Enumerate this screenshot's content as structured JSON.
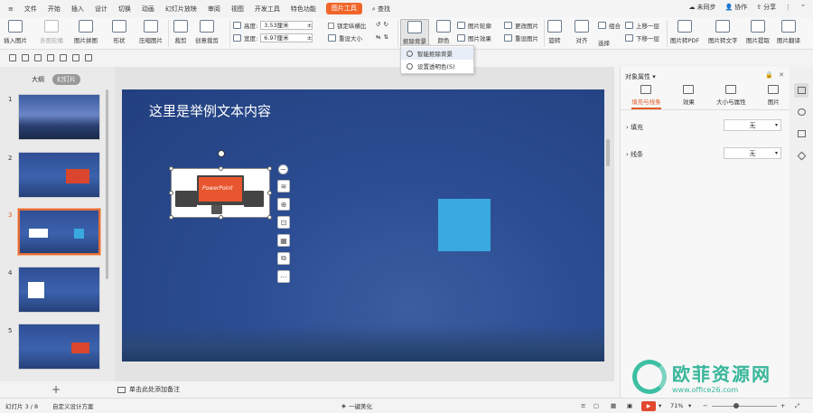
{
  "menu": {
    "hamburger": "≡",
    "items": [
      "文件",
      "开始",
      "插入",
      "设计",
      "切换",
      "动画",
      "幻灯片放映",
      "审阅",
      "视图",
      "开发工具",
      "特色功能"
    ],
    "active_tab": "图片工具",
    "search": "查找",
    "right": {
      "sync": "未同步",
      "collab": "协作",
      "share": "分享"
    }
  },
  "ribbon": {
    "insert_picture": "插入图片",
    "multi_crop": "多图轮播",
    "picture_splice": "图片拼图",
    "shape": "形状",
    "compress": "压缩图片",
    "crop": "裁剪",
    "creative_crop": "创意裁剪",
    "height_label": "高度:",
    "height_value": "3.53厘米",
    "width_label": "宽度:",
    "width_value": "6.97厘米",
    "lock_ratio": "锁定纵横比",
    "reset_size": "重设大小",
    "remove_bg": "抠除背景",
    "color": "颜色",
    "outline": "图片轮廓",
    "effect": "图片效果",
    "change_picture": "更改图片",
    "reset_picture": "重设图片",
    "rotate": "旋转",
    "align": "对齐",
    "group": "组合",
    "select": "选择",
    "bring_forward": "上移一层",
    "send_backward": "下移一层",
    "to_pdf": "图片转PDF",
    "to_text": "图片转文字",
    "extract": "图片提取",
    "translate": "图片翻译"
  },
  "dropdown": {
    "items": [
      "智能抠除背景",
      "设置透明色(S)"
    ]
  },
  "left_panel": {
    "tabs": [
      "大纲",
      "幻灯片"
    ],
    "active_tab": "幻灯片",
    "slide_numbers": [
      "1",
      "2",
      "3",
      "4",
      "5"
    ],
    "current_slide": "3",
    "add": "+"
  },
  "slide": {
    "title": "这里是举例文本内容",
    "picture_text": "PowerPoint",
    "rect_color": "#3aa9e0"
  },
  "float_tools": [
    "−",
    "≋",
    "⊕",
    "⊡",
    "▦",
    "⧉",
    "⋯"
  ],
  "notes": {
    "placeholder": "单击此处添加备注"
  },
  "right_panel": {
    "title": "对象属性",
    "tabs": [
      "填充与线条",
      "效果",
      "大小与属性",
      "图片"
    ],
    "active_tab": "填充与线条",
    "fill_label": "填充",
    "fill_value": "无",
    "line_label": "线条",
    "line_value": "无"
  },
  "status": {
    "slide_info": "幻灯片 3 / 8",
    "design": "自定义设计方案",
    "beautify": "一键美化",
    "zoom": "71%",
    "zoom_fraction": 0.38
  },
  "watermark": {
    "title": "欧菲资源网",
    "url": "www.office26.com"
  },
  "colors": {
    "accent": "#f0662a",
    "slide_bg": "#2c4d93",
    "watermark": "#37b69a"
  }
}
